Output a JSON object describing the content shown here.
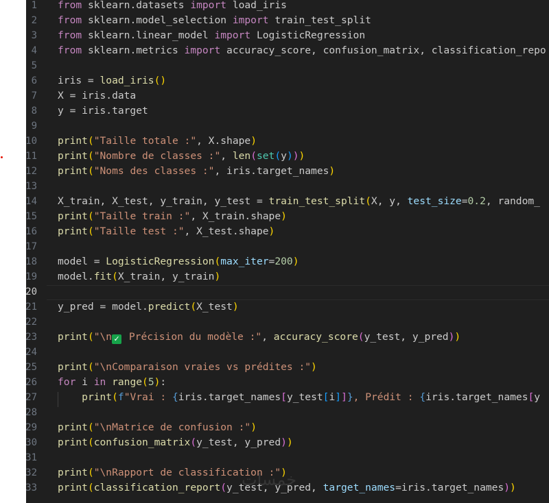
{
  "editor": {
    "language": "python",
    "active_line": 20,
    "lines": [
      {
        "n": "1",
        "tokens": [
          [
            "from",
            "kw"
          ],
          [
            " sklearn.datasets ",
            "plain"
          ],
          [
            "import",
            "kw"
          ],
          [
            " load_iris",
            "plain"
          ]
        ]
      },
      {
        "n": "2",
        "tokens": [
          [
            "from",
            "kw"
          ],
          [
            " sklearn.model_selection ",
            "plain"
          ],
          [
            "import",
            "kw"
          ],
          [
            " train_test_split",
            "plain"
          ]
        ]
      },
      {
        "n": "3",
        "tokens": [
          [
            "from",
            "kw"
          ],
          [
            " sklearn.linear_model ",
            "plain"
          ],
          [
            "import",
            "kw"
          ],
          [
            " LogisticRegression",
            "plain"
          ]
        ]
      },
      {
        "n": "4",
        "tokens": [
          [
            "from",
            "kw"
          ],
          [
            " sklearn.metrics ",
            "plain"
          ],
          [
            "import",
            "kw"
          ],
          [
            " accuracy_score, confusion_matrix, classification_repo",
            "plain"
          ]
        ]
      },
      {
        "n": "5",
        "tokens": []
      },
      {
        "n": "6",
        "tokens": [
          [
            "iris = ",
            "plain"
          ],
          [
            "load_iris",
            "fn"
          ],
          [
            "()",
            "par1"
          ]
        ]
      },
      {
        "n": "7",
        "tokens": [
          [
            "X = iris.data",
            "plain"
          ]
        ]
      },
      {
        "n": "8",
        "tokens": [
          [
            "y = iris.target",
            "plain"
          ]
        ]
      },
      {
        "n": "9",
        "tokens": []
      },
      {
        "n": "10",
        "tokens": [
          [
            "print",
            "fn"
          ],
          [
            "(",
            "par1"
          ],
          [
            "\"Taille totale :\"",
            "str"
          ],
          [
            ", X.shape",
            "plain"
          ],
          [
            ")",
            "par1"
          ]
        ]
      },
      {
        "n": "11",
        "tokens": [
          [
            "print",
            "fn"
          ],
          [
            "(",
            "par1"
          ],
          [
            "\"Nombre de classes :\"",
            "str"
          ],
          [
            ", ",
            "plain"
          ],
          [
            "len",
            "fn"
          ],
          [
            "(",
            "par2"
          ],
          [
            "set",
            "cls"
          ],
          [
            "(",
            "par3"
          ],
          [
            "y",
            "plain"
          ],
          [
            ")",
            "par3"
          ],
          [
            ")",
            "par2"
          ],
          [
            ")",
            "par1"
          ]
        ]
      },
      {
        "n": "12",
        "tokens": [
          [
            "print",
            "fn"
          ],
          [
            "(",
            "par1"
          ],
          [
            "\"Noms des classes :\"",
            "str"
          ],
          [
            ", iris.target_names",
            "plain"
          ],
          [
            ")",
            "par1"
          ]
        ]
      },
      {
        "n": "13",
        "tokens": []
      },
      {
        "n": "14",
        "tokens": [
          [
            "X_train, X_test, y_train, y_test = ",
            "plain"
          ],
          [
            "train_test_split",
            "fn"
          ],
          [
            "(",
            "par1"
          ],
          [
            "X, y, ",
            "plain"
          ],
          [
            "test_size",
            "var"
          ],
          [
            "=",
            "plain"
          ],
          [
            "0.2",
            "num"
          ],
          [
            ", random_",
            "plain"
          ]
        ]
      },
      {
        "n": "15",
        "tokens": [
          [
            "print",
            "fn"
          ],
          [
            "(",
            "par1"
          ],
          [
            "\"Taille train :\"",
            "str"
          ],
          [
            ", X_train.shape",
            "plain"
          ],
          [
            ")",
            "par1"
          ]
        ]
      },
      {
        "n": "16",
        "tokens": [
          [
            "print",
            "fn"
          ],
          [
            "(",
            "par1"
          ],
          [
            "\"Taille test :\"",
            "str"
          ],
          [
            ", X_test.shape",
            "plain"
          ],
          [
            ")",
            "par1"
          ]
        ]
      },
      {
        "n": "17",
        "tokens": []
      },
      {
        "n": "18",
        "tokens": [
          [
            "model = ",
            "plain"
          ],
          [
            "LogisticRegression",
            "fn"
          ],
          [
            "(",
            "par1"
          ],
          [
            "max_iter",
            "var"
          ],
          [
            "=",
            "plain"
          ],
          [
            "200",
            "num"
          ],
          [
            ")",
            "par1"
          ]
        ]
      },
      {
        "n": "19",
        "tokens": [
          [
            "model.",
            "plain"
          ],
          [
            "fit",
            "fn"
          ],
          [
            "(",
            "par1"
          ],
          [
            "X_train, y_train",
            "plain"
          ],
          [
            ")",
            "par1"
          ]
        ]
      },
      {
        "n": "20",
        "tokens": []
      },
      {
        "n": "21",
        "tokens": [
          [
            "y_pred = model.",
            "plain"
          ],
          [
            "predict",
            "fn"
          ],
          [
            "(",
            "par1"
          ],
          [
            "X_test",
            "plain"
          ],
          [
            ")",
            "par1"
          ]
        ]
      },
      {
        "n": "22",
        "tokens": []
      },
      {
        "n": "23",
        "tokens": [
          [
            "print",
            "fn"
          ],
          [
            "(",
            "par1"
          ],
          [
            "\"\\n",
            "str"
          ],
          [
            "✓",
            "check"
          ],
          [
            " Précision du modèle :\"",
            "str"
          ],
          [
            ", ",
            "plain"
          ],
          [
            "accuracy_score",
            "fn"
          ],
          [
            "(",
            "par2"
          ],
          [
            "y_test, y_pred",
            "plain"
          ],
          [
            ")",
            "par2"
          ],
          [
            ")",
            "par1"
          ]
        ]
      },
      {
        "n": "24",
        "tokens": []
      },
      {
        "n": "25",
        "tokens": [
          [
            "print",
            "fn"
          ],
          [
            "(",
            "par1"
          ],
          [
            "\"\\nComparaison vraies vs prédites :\"",
            "str"
          ],
          [
            ")",
            "par1"
          ]
        ]
      },
      {
        "n": "26",
        "tokens": [
          [
            "for",
            "kw"
          ],
          [
            " i ",
            "plain"
          ],
          [
            "in",
            "kw"
          ],
          [
            " ",
            "plain"
          ],
          [
            "range",
            "fn"
          ],
          [
            "(",
            "par1"
          ],
          [
            "5",
            "num"
          ],
          [
            ")",
            "par1"
          ],
          [
            ":",
            "plain"
          ]
        ]
      },
      {
        "n": "27",
        "tokens": [
          [
            "    ",
            "plain"
          ],
          [
            "print",
            "fn"
          ],
          [
            "(",
            "par1"
          ],
          [
            "f",
            "kw2"
          ],
          [
            "\"Vrai : ",
            "str"
          ],
          [
            "{",
            "kw2"
          ],
          [
            "iris.target_names",
            "plain"
          ],
          [
            "[",
            "par2"
          ],
          [
            "y_test",
            "plain"
          ],
          [
            "[",
            "par3"
          ],
          [
            "i",
            "plain"
          ],
          [
            "]",
            "par3"
          ],
          [
            "]",
            "par2"
          ],
          [
            "}",
            "kw2"
          ],
          [
            ", Prédit : ",
            "str"
          ],
          [
            "{",
            "kw2"
          ],
          [
            "iris.target_names",
            "plain"
          ],
          [
            "[",
            "par2"
          ],
          [
            "y",
            "plain"
          ]
        ]
      },
      {
        "n": "28",
        "tokens": []
      },
      {
        "n": "29",
        "tokens": [
          [
            "print",
            "fn"
          ],
          [
            "(",
            "par1"
          ],
          [
            "\"\\nMatrice de confusion :\"",
            "str"
          ],
          [
            ")",
            "par1"
          ]
        ]
      },
      {
        "n": "30",
        "tokens": [
          [
            "print",
            "fn"
          ],
          [
            "(",
            "par1"
          ],
          [
            "confusion_matrix",
            "fn"
          ],
          [
            "(",
            "par2"
          ],
          [
            "y_test, y_pred",
            "plain"
          ],
          [
            ")",
            "par2"
          ],
          [
            ")",
            "par1"
          ]
        ]
      },
      {
        "n": "31",
        "tokens": []
      },
      {
        "n": "32",
        "tokens": [
          [
            "print",
            "fn"
          ],
          [
            "(",
            "par1"
          ],
          [
            "\"\\nRapport de classification :\"",
            "str"
          ],
          [
            ")",
            "par1"
          ]
        ]
      },
      {
        "n": "33",
        "tokens": [
          [
            "print",
            "fn"
          ],
          [
            "(",
            "par1"
          ],
          [
            "classification_report",
            "fn"
          ],
          [
            "(",
            "par2"
          ],
          [
            "y_test, y_pred, ",
            "plain"
          ],
          [
            "target_names",
            "var"
          ],
          [
            "=",
            "plain"
          ],
          [
            "iris.target_names",
            "plain"
          ],
          [
            ")",
            "par2"
          ],
          [
            ")",
            "par1"
          ]
        ]
      }
    ]
  },
  "watermark": {
    "text": "خمسات"
  }
}
